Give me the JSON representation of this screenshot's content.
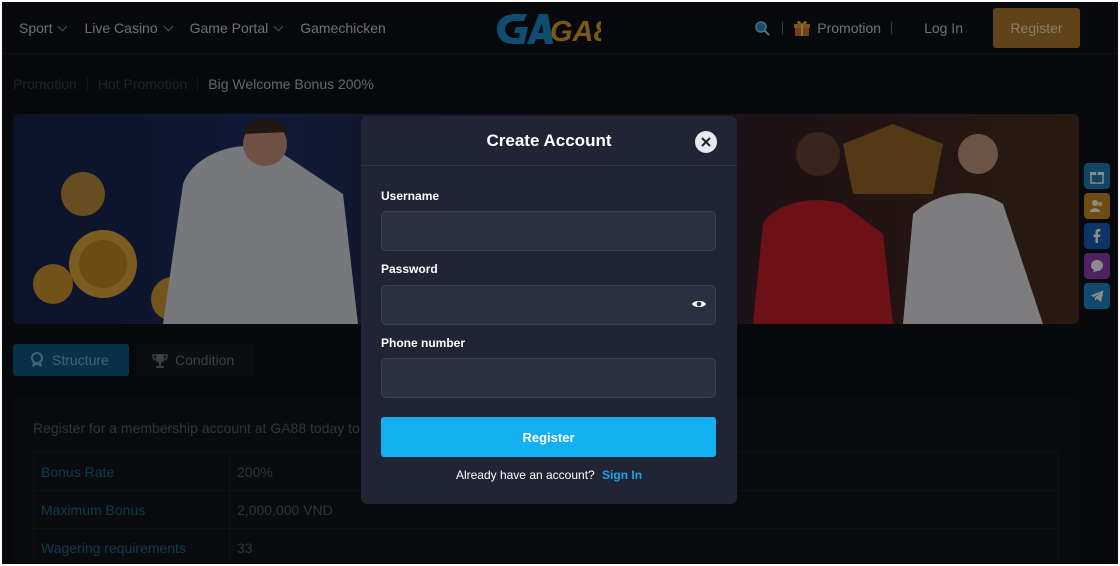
{
  "nav": {
    "items": [
      {
        "label": "Sport",
        "dropdown": true
      },
      {
        "label": "Live Casino",
        "dropdown": true
      },
      {
        "label": "Game Portal",
        "dropdown": true
      },
      {
        "label": "Gamechicken",
        "dropdown": false
      }
    ]
  },
  "header": {
    "logo_text": "GA88",
    "promotion_label": "Promotion",
    "login_label": "Log In",
    "register_label": "Register"
  },
  "breadcrumb": [
    "Promotion",
    "Hot Promotion",
    "Big Welcome Bonus 200%"
  ],
  "tabs": [
    {
      "label": "Structure",
      "active": true
    },
    {
      "label": "Condition",
      "active": false
    }
  ],
  "content": {
    "intro": "Register for a membership account at GA88 today to",
    "rows": [
      {
        "key": "Bonus Rate",
        "value": "200%"
      },
      {
        "key": "Maximum Bonus",
        "value": "2,000,000 VND"
      },
      {
        "key": "Wagering requirements",
        "value": "33"
      }
    ]
  },
  "side_buttons": [
    {
      "icon": "gift-icon",
      "color": "#1f7fb8"
    },
    {
      "icon": "user-group-icon",
      "color": "#c98a22"
    },
    {
      "icon": "facebook-icon",
      "color": "#1a5fb8"
    },
    {
      "icon": "chat-icon",
      "color": "#8a3fb0"
    },
    {
      "icon": "telegram-icon",
      "color": "#1f88c9"
    }
  ],
  "modal": {
    "title": "Create Account",
    "fields": [
      {
        "label": "Username",
        "value": "",
        "placeholder": ""
      },
      {
        "label": "Password",
        "value": "",
        "placeholder": ""
      },
      {
        "label": "Phone number",
        "value": "",
        "placeholder": ""
      }
    ],
    "submit_label": "Register",
    "signin_prompt": "Already have an account?",
    "signin_link": "Sign In"
  },
  "colors": {
    "accent": "#12b0f0",
    "header_register": "#b07a2a",
    "background": "#0f1117"
  }
}
